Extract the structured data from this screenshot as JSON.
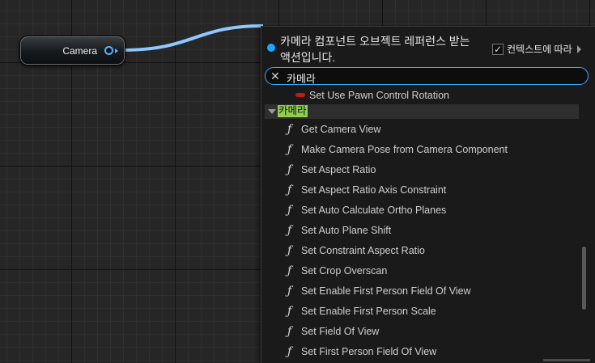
{
  "node": {
    "label": "Camera"
  },
  "panel": {
    "title": "카메라 컴포넌트 오브젝트 레퍼런스 받는 액션입니다.",
    "context_checkbox": {
      "checked": true,
      "label": "컨텍스트에 따라"
    },
    "search": {
      "value": "카메라"
    },
    "items_before": [
      {
        "label": "Set Use Pawn Control Rotation",
        "icon": "red-pin-icon"
      }
    ],
    "category": {
      "label": "카메라"
    },
    "functions": [
      "Get Camera View",
      "Make Camera Pose from Camera Component",
      "Set Aspect Ratio",
      "Set Aspect Ratio Axis Constraint",
      "Set Auto Calculate Ortho Planes",
      "Set Auto Plane Shift",
      "Set Constraint Aspect Ratio",
      "Set Crop Overscan",
      "Set Enable First Person Field Of View",
      "Set Enable First Person Scale",
      "Set Field Of View",
      "Set First Person Field Of View"
    ],
    "function_icon_glyph": "ƒ"
  },
  "colors": {
    "accent": "#3fa7ff",
    "wire": "#8ec8ff",
    "category_highlight": "#8fce4e",
    "pin_red": "#c01a1a"
  }
}
